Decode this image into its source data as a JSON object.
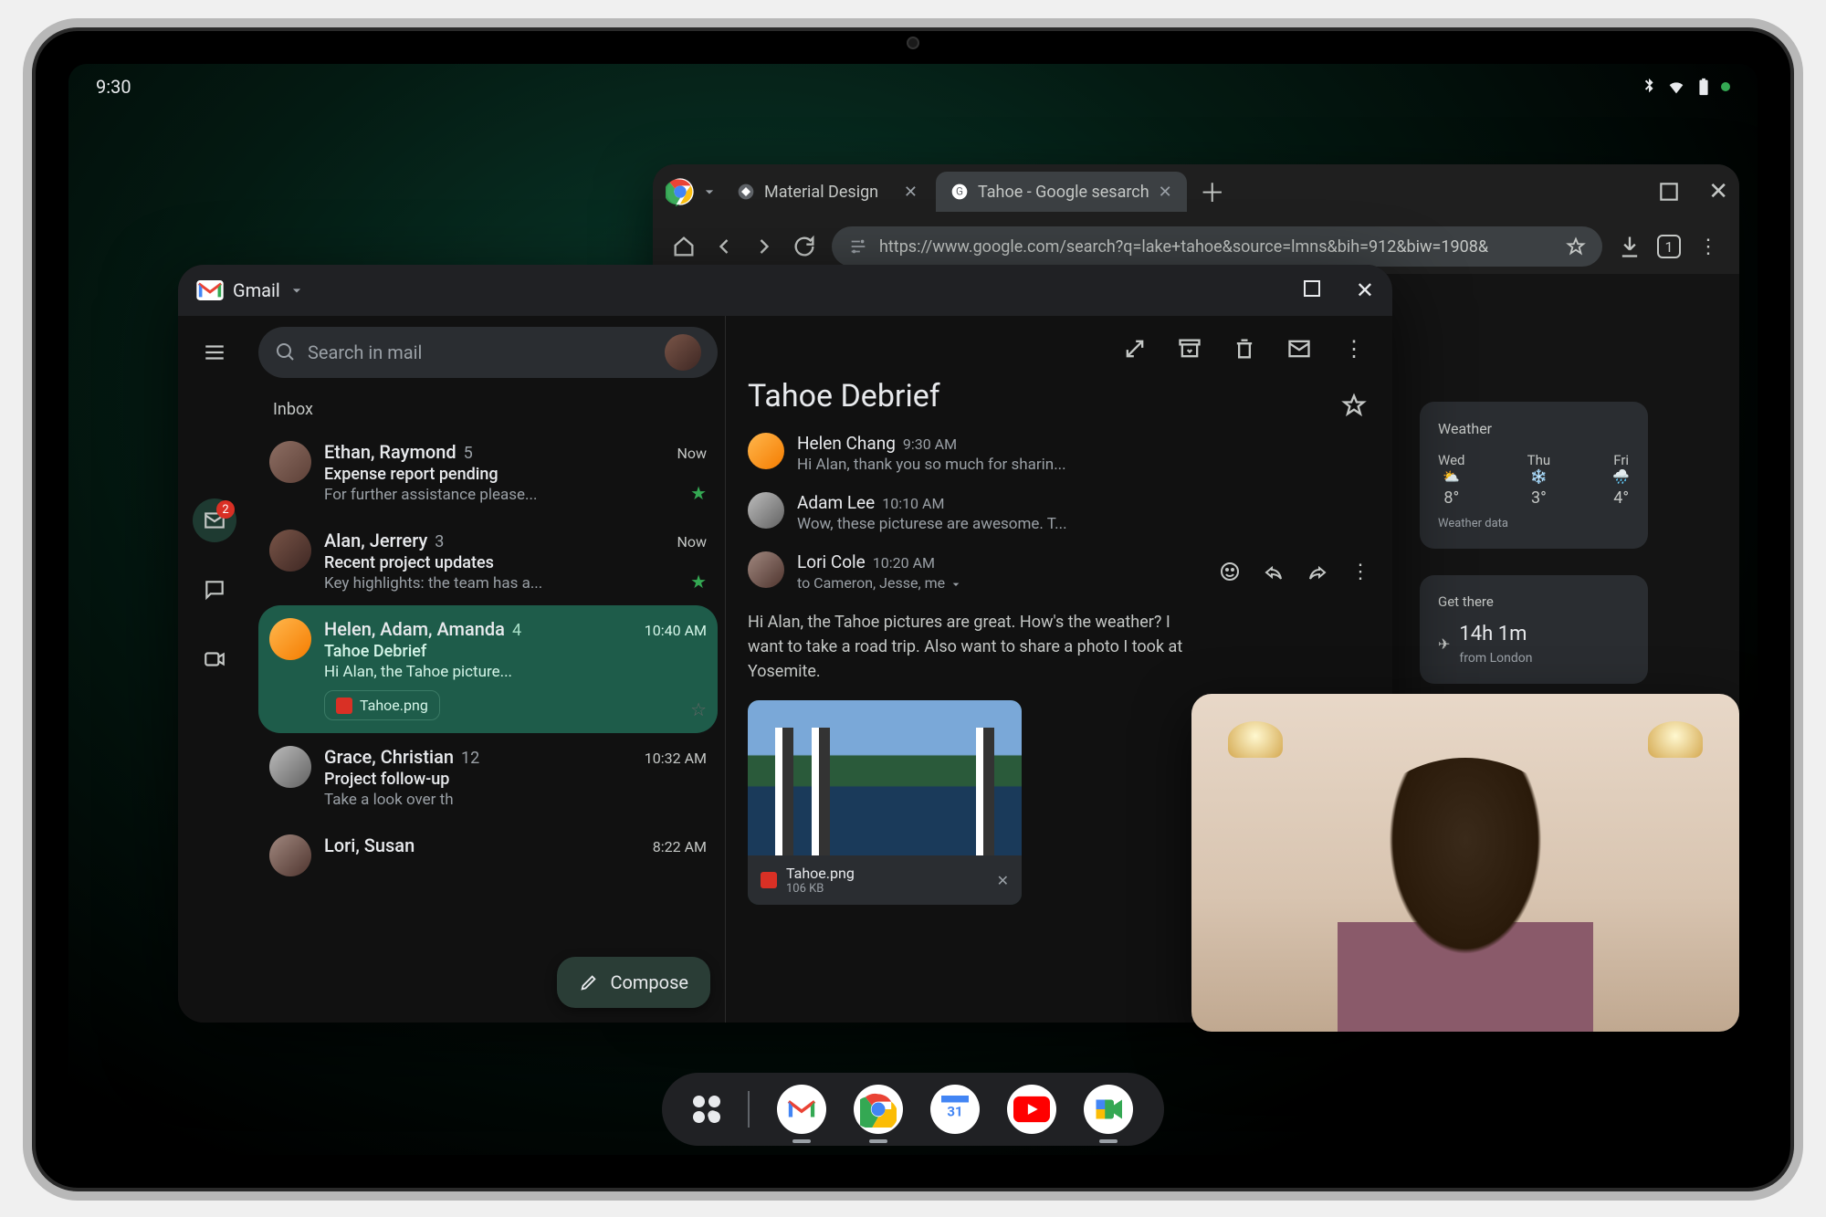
{
  "statusbar": {
    "time": "9:30"
  },
  "chrome": {
    "tabs": [
      {
        "title": "Material Design"
      },
      {
        "title": "Tahoe - Google sesarch"
      }
    ],
    "url": "https://www.google.com/search?q=lake+tahoe&source=lmns&bih=912&biw=1908&",
    "weather": {
      "title": "Weather",
      "data_label": "Weather data",
      "days": [
        {
          "label": "Wed",
          "temp": "8°"
        },
        {
          "label": "Thu",
          "temp": "3°"
        },
        {
          "label": "Fri",
          "temp": "4°"
        }
      ]
    },
    "travel": {
      "title": "Get there",
      "duration": "14h 1m",
      "from": "from London"
    }
  },
  "gmail": {
    "app_title": "Gmail",
    "search_placeholder": "Search in mail",
    "inbox_label": "Inbox",
    "mail_badge": "2",
    "compose_label": "Compose",
    "emails": [
      {
        "sender": "Ethan, Raymond",
        "count": "5",
        "time": "Now",
        "subject": "Expense report pending",
        "preview": "For further assistance please..."
      },
      {
        "sender": "Alan, Jerrery",
        "count": "3",
        "time": "Now",
        "subject": "Recent project updates",
        "preview": "Key highlights: the team has a..."
      },
      {
        "sender": "Helen, Adam, Amanda",
        "count": "4",
        "time": "10:40 AM",
        "subject": "Tahoe Debrief",
        "preview": "Hi Alan, the Tahoe picture...",
        "attachment": "Tahoe.png"
      },
      {
        "sender": "Grace, Christian",
        "count": "12",
        "time": "10:32 AM",
        "subject": "Project follow-up",
        "preview": "Take a look over th"
      },
      {
        "sender": "Lori, Susan",
        "count": "",
        "time": "8:22 AM",
        "subject": "",
        "preview": ""
      }
    ],
    "detail": {
      "subject": "Tahoe Debrief",
      "messages": [
        {
          "name": "Helen Chang",
          "time": "9:30 AM",
          "snippet": "Hi Alan, thank you so much for sharin..."
        },
        {
          "name": "Adam Lee",
          "time": "10:10 AM",
          "snippet": "Wow, these picturese are awesome. T..."
        },
        {
          "name": "Lori Cole",
          "time": "10:20 AM",
          "to": "to Cameron, Jesse, me"
        }
      ],
      "body": "Hi Alan, the Tahoe pictures are great. How's the weather? I want to take a road trip. Also want to share a photo I took at Yosemite.",
      "attachment": {
        "name": "Tahoe.png",
        "size": "106 KB"
      }
    }
  }
}
